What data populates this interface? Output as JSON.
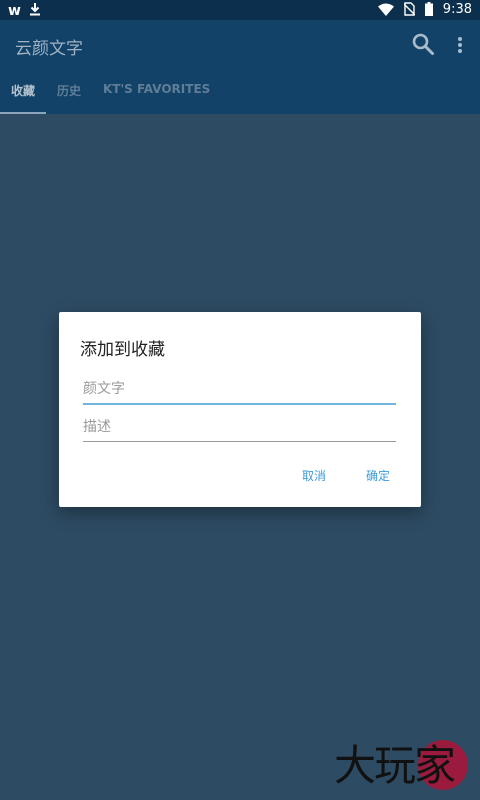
{
  "status_bar": {
    "app_glyph": "w",
    "time": "9:38",
    "icons": [
      "download-icon",
      "wifi-icon",
      "no-sim-icon",
      "battery-icon"
    ]
  },
  "app_bar": {
    "title": "云颜文字",
    "actions": [
      "search-icon",
      "more-vert-icon"
    ]
  },
  "tabs": [
    {
      "label": "收藏",
      "selected": true
    },
    {
      "label": "历史",
      "selected": false
    },
    {
      "label": "KT'S FAVORITES",
      "selected": false
    }
  ],
  "dialog": {
    "title": "添加到收藏",
    "emoticon_placeholder": "颜文字",
    "emoticon_value": "",
    "description_placeholder": "描述",
    "description_value": "",
    "cancel_label": "取消",
    "ok_label": "确定"
  },
  "watermark": {
    "text": "大玩家"
  },
  "colors": {
    "background": "#2d4b63",
    "app_bar": "#134268",
    "status_bar": "#0c2f4e",
    "accent": "#3d9ad8",
    "watermark_circle": "#9a1b3d"
  }
}
